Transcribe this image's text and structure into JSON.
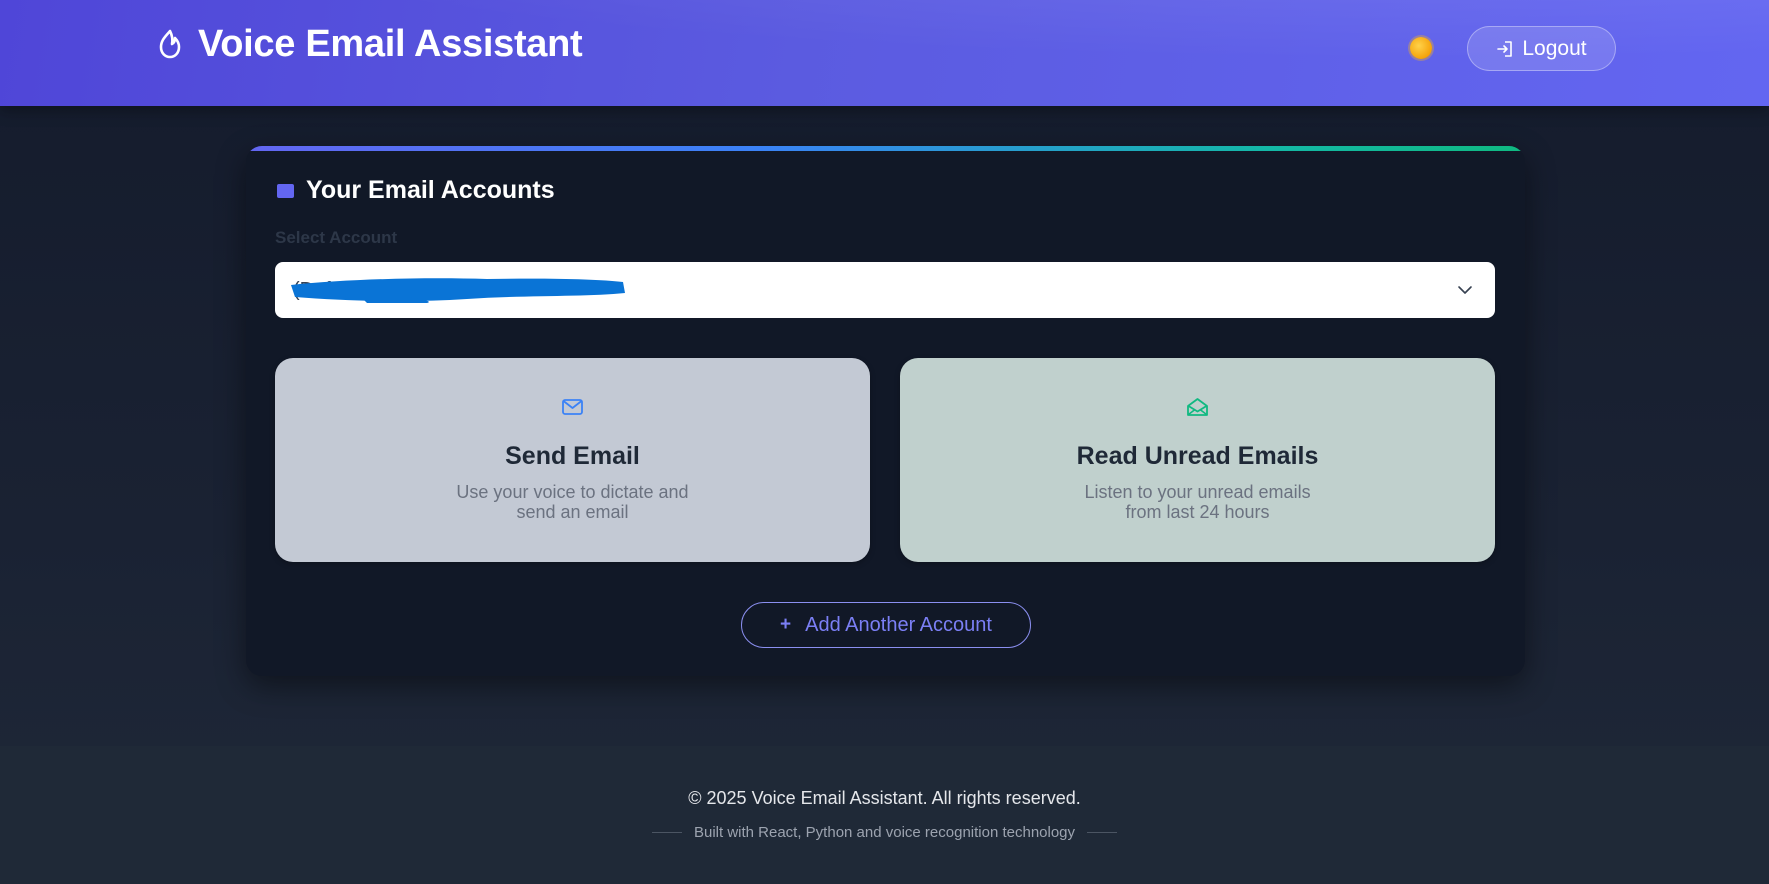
{
  "header": {
    "title": "Voice Email Assistant",
    "logo_icon": "flame-icon",
    "theme_icon": "sun-icon",
    "logout_label": "Logout",
    "logout_icon": "logout-icon"
  },
  "accounts": {
    "title": "Your Email Accounts",
    "select_label": "Select Account",
    "selected_value": "(Default)",
    "selected_value_redacted": true
  },
  "actions": [
    {
      "title": "Send Email",
      "description": "Use your voice to dictate and send an email",
      "icon": "mail-icon",
      "icon_color": "#3b82f6"
    },
    {
      "title": "Read Unread Emails",
      "description": "Listen to your unread emails from last 24 hours",
      "icon": "mail-open-icon",
      "icon_color": "#10b981"
    }
  ],
  "add_account": {
    "label": "Add Another Account",
    "icon": "plus-icon"
  },
  "footer": {
    "copyright": "© 2025 Voice Email Assistant. All rights reserved.",
    "tagline": "Built with React, Python and voice recognition technology"
  },
  "colors": {
    "header_start": "#4f46d8",
    "header_end": "#6366f1",
    "accent": "#6366f1",
    "background": "#141b2c",
    "card_background": "#111827",
    "footer_background": "#1f2937"
  }
}
